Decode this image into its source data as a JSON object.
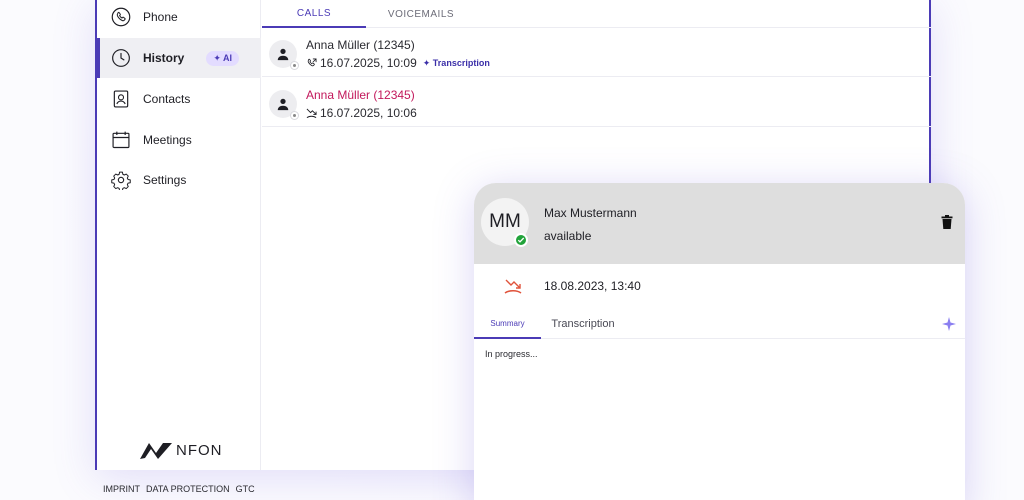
{
  "sidebar": {
    "items": [
      {
        "label": "Phone",
        "icon": "phone-icon"
      },
      {
        "label": "History",
        "icon": "clock-icon",
        "badge": "✦ AI",
        "active": true
      },
      {
        "label": "Contacts",
        "icon": "contact-card-icon"
      },
      {
        "label": "Meetings",
        "icon": "calendar-icon"
      },
      {
        "label": "Settings",
        "icon": "gear-icon"
      }
    ],
    "logo_text": "NFON"
  },
  "tabs": [
    {
      "label": "CALLS",
      "active": true
    },
    {
      "label": "VOICEMAILS",
      "active": false
    }
  ],
  "calls": [
    {
      "name": "Anna Müller (12345)",
      "datetime": "16.07.2025, 10:09",
      "type": "outgoing",
      "transcription_label": "✦ Transcription",
      "missed": false
    },
    {
      "name": "Anna Müller (12345)",
      "datetime": "16.07.2025, 10:06",
      "type": "missed",
      "missed": true
    }
  ],
  "footer": {
    "links": [
      "IMPRINT",
      "DATA PROTECTION",
      "GTC"
    ]
  },
  "detail": {
    "initials": "MM",
    "name": "Max Mustermann",
    "status": "available",
    "call_datetime": "18.08.2023, 13:40",
    "tabs": [
      "Summary",
      "Transcription"
    ],
    "content": "In progress..."
  },
  "colors": {
    "accent": "#4b3bb6",
    "missed": "#c2185b",
    "available": "#21a33a",
    "missed_icon": "#e0533b"
  }
}
